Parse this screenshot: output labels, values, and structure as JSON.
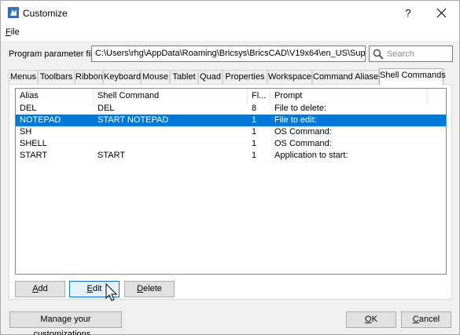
{
  "window": {
    "title": "Customize",
    "help_label": "?",
    "colors": {
      "selection": "#0078d7",
      "app_icon": "#2f6fc4"
    }
  },
  "menu": {
    "file_label_first": "F",
    "file_label_rest": "ile"
  },
  "param": {
    "label": "Program parameter file:",
    "value": "C:\\Users\\rhg\\AppData\\Roaming\\Bricsys\\BricsCAD\\V19x64\\en_US\\Support\\default",
    "search_placeholder": "Search"
  },
  "tabs": [
    {
      "label": "Menus"
    },
    {
      "label": "Toolbars"
    },
    {
      "label": "Ribbon"
    },
    {
      "label": "Keyboard"
    },
    {
      "label": "Mouse"
    },
    {
      "label": "Tablet"
    },
    {
      "label": "Quad"
    },
    {
      "label": "Properties"
    },
    {
      "label": "Workspaces"
    },
    {
      "label": "Command Aliases"
    },
    {
      "label": "Shell Commands",
      "active": true
    }
  ],
  "list": {
    "columns": [
      "Alias",
      "Shell Command",
      "Fl...",
      "Prompt"
    ],
    "rows": [
      {
        "alias": "DEL",
        "command": "DEL",
        "flag": "8",
        "prompt": "File to delete:"
      },
      {
        "alias": "NOTEPAD",
        "command": "START NOTEPAD",
        "flag": "1",
        "prompt": "File to edit:",
        "selected": true
      },
      {
        "alias": "SH",
        "command": "",
        "flag": "1",
        "prompt": "OS Command:"
      },
      {
        "alias": "SHELL",
        "command": "",
        "flag": "1",
        "prompt": "OS Command:"
      },
      {
        "alias": "START",
        "command": "START",
        "flag": "1",
        "prompt": "Application to start:"
      }
    ]
  },
  "buttons": {
    "add_first": "A",
    "add_rest": "dd",
    "edit_first": "E",
    "edit_rest": "dit",
    "delete_first": "D",
    "delete_rest": "elete",
    "manage": "Manage your customizations...",
    "ok_first": "O",
    "ok_rest": "K",
    "cancel_first": "C",
    "cancel_rest": "ancel"
  }
}
